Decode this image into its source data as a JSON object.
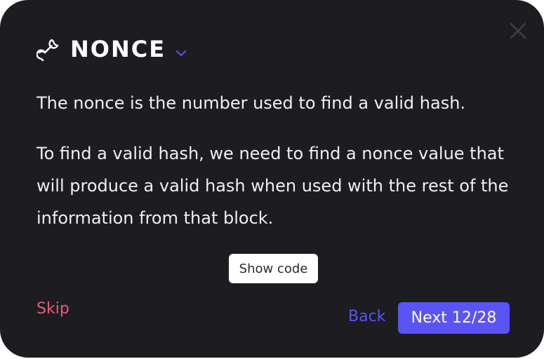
{
  "modal": {
    "title": "NONCE",
    "icons": {
      "title_icon": "wrench-icon",
      "dropdown_icon": "chevron-down-icon",
      "close_icon": "close-icon"
    },
    "paragraphs": [
      "The nonce is the number used to find a valid hash.",
      "To find a valid hash, we need to find a nonce value that will produce a valid hash when used with the rest of the information from that block."
    ],
    "show_code_label": "Show code",
    "skip_label": "Skip",
    "back_label": "Back",
    "next_label": "Next 12/28"
  },
  "colors": {
    "background": "#1c1c21",
    "accent": "#5b54f5",
    "skip": "#ee5a78"
  }
}
